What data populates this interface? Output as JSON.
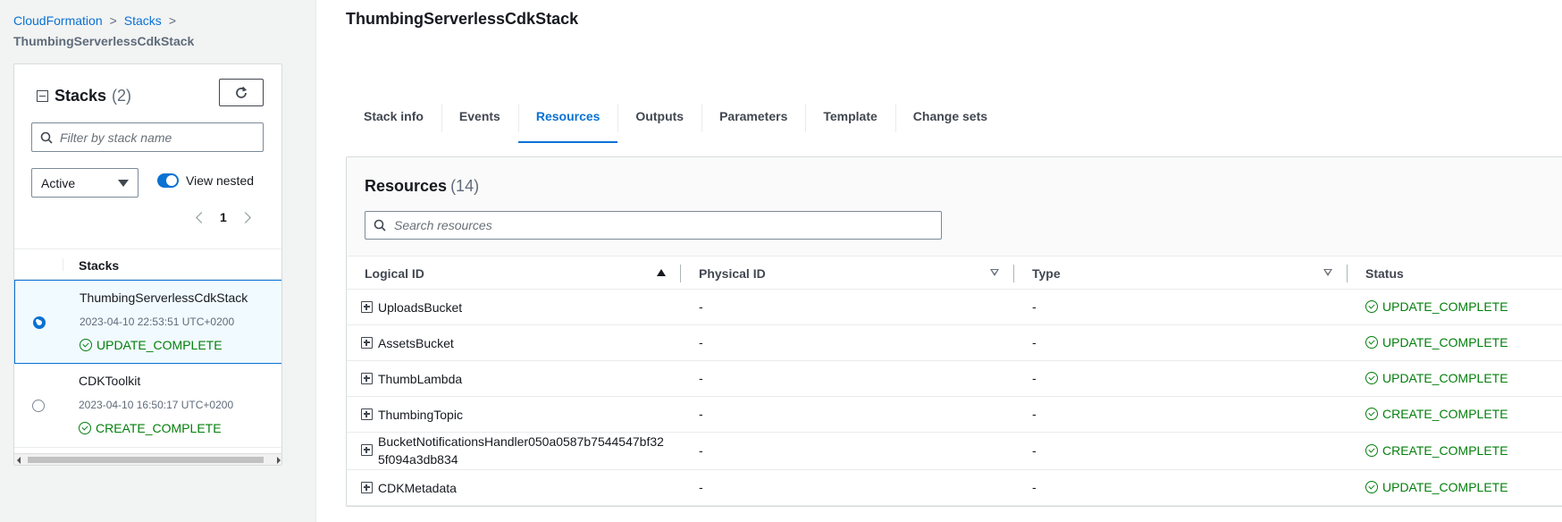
{
  "breadcrumb": {
    "items": [
      "CloudFormation",
      "Stacks"
    ],
    "current": "ThumbingServerlessCdkStack"
  },
  "stacks_panel": {
    "title": "Stacks",
    "count": "(2)",
    "filter_placeholder": "Filter by stack name",
    "status_filter": "Active",
    "view_nested_label": "View nested",
    "page": "1",
    "column_header": "Stacks",
    "stacks": [
      {
        "name": "ThumbingServerlessCdkStack",
        "date": "2023-04-10 22:53:51 UTC+0200",
        "status": "UPDATE_COMPLETE",
        "selected": true
      },
      {
        "name": "CDKToolkit",
        "date": "2023-04-10 16:50:17 UTC+0200",
        "status": "CREATE_COMPLETE",
        "selected": false
      }
    ]
  },
  "main": {
    "title": "ThumbingServerlessCdkStack",
    "tabs": [
      "Stack info",
      "Events",
      "Resources",
      "Outputs",
      "Parameters",
      "Template",
      "Change sets"
    ],
    "active_tab": "Resources",
    "resources": {
      "title": "Resources",
      "count": "(14)",
      "search_placeholder": "Search resources",
      "columns": [
        "Logical ID",
        "Physical ID",
        "Type",
        "Status"
      ],
      "rows": [
        {
          "logical_id": "UploadsBucket",
          "physical_id": "-",
          "type": "-",
          "status": "UPDATE_COMPLETE"
        },
        {
          "logical_id": "AssetsBucket",
          "physical_id": "-",
          "type": "-",
          "status": "UPDATE_COMPLETE"
        },
        {
          "logical_id": "ThumbLambda",
          "physical_id": "-",
          "type": "-",
          "status": "UPDATE_COMPLETE"
        },
        {
          "logical_id": "ThumbingTopic",
          "physical_id": "-",
          "type": "-",
          "status": "CREATE_COMPLETE"
        },
        {
          "logical_id": "BucketNotificationsHandler050a0587b7544547bf325f094a3db834",
          "physical_id": "-",
          "type": "-",
          "status": "CREATE_COMPLETE"
        },
        {
          "logical_id": "CDKMetadata",
          "physical_id": "-",
          "type": "-",
          "status": "UPDATE_COMPLETE"
        }
      ]
    }
  },
  "colors": {
    "link": "#0972d3",
    "success": "#037f0c",
    "selected_bg": "#f1faff"
  }
}
